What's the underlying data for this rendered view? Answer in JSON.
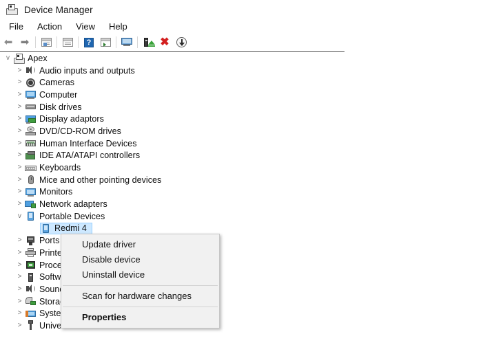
{
  "window": {
    "title": "Device Manager",
    "icon": "device-manager-icon"
  },
  "menubar": {
    "items": [
      {
        "label": "File"
      },
      {
        "label": "Action"
      },
      {
        "label": "View"
      },
      {
        "label": "Help"
      }
    ]
  },
  "toolbar": {
    "buttons": [
      {
        "icon": "back-arrow-icon",
        "label": "Back"
      },
      {
        "icon": "forward-arrow-icon",
        "label": "Forward"
      },
      {
        "icon": "show-hidden-devices-icon",
        "label": "Show hidden devices"
      },
      {
        "icon": "properties-icon",
        "label": "Properties"
      },
      {
        "icon": "help-icon",
        "label": "Help"
      },
      {
        "icon": "update-driver-icon",
        "label": "Update driver"
      },
      {
        "icon": "scan-hardware-icon",
        "label": "Scan for hardware changes"
      },
      {
        "icon": "enable-device-icon",
        "label": "Enable device"
      },
      {
        "icon": "uninstall-device-icon",
        "label": "Uninstall device"
      },
      {
        "icon": "download-icon",
        "label": "Download"
      }
    ]
  },
  "tree": {
    "nodes": [
      {
        "label": "Apex",
        "level": 0,
        "chevron": "v",
        "icon": "computer-root-icon",
        "selected": false
      },
      {
        "label": "Audio inputs and outputs",
        "level": 1,
        "chevron": ">",
        "icon": "speaker-icon",
        "selected": false
      },
      {
        "label": "Cameras",
        "level": 1,
        "chevron": ">",
        "icon": "camera-icon",
        "selected": false
      },
      {
        "label": "Computer",
        "level": 1,
        "chevron": ">",
        "icon": "computer-icon",
        "selected": false
      },
      {
        "label": "Disk drives",
        "level": 1,
        "chevron": ">",
        "icon": "disk-drive-icon",
        "selected": false
      },
      {
        "label": "Display adaptors",
        "level": 1,
        "chevron": ">",
        "icon": "display-adapter-icon",
        "selected": false
      },
      {
        "label": "DVD/CD-ROM drives",
        "level": 1,
        "chevron": ">",
        "icon": "dvd-drive-icon",
        "selected": false
      },
      {
        "label": "Human Interface Devices",
        "level": 1,
        "chevron": ">",
        "icon": "hid-icon",
        "selected": false
      },
      {
        "label": "IDE ATA/ATAPI controllers",
        "level": 1,
        "chevron": ">",
        "icon": "ide-controller-icon",
        "selected": false
      },
      {
        "label": "Keyboards",
        "level": 1,
        "chevron": ">",
        "icon": "keyboard-icon",
        "selected": false
      },
      {
        "label": "Mice and other pointing devices",
        "level": 1,
        "chevron": ">",
        "icon": "mouse-icon",
        "selected": false
      },
      {
        "label": "Monitors",
        "level": 1,
        "chevron": ">",
        "icon": "monitor-icon",
        "selected": false
      },
      {
        "label": "Network adapters",
        "level": 1,
        "chevron": ">",
        "icon": "network-adapter-icon",
        "selected": false
      },
      {
        "label": "Portable Devices",
        "level": 1,
        "chevron": "v",
        "icon": "portable-device-icon",
        "selected": false
      },
      {
        "label": "Redmi 4",
        "level": 2,
        "chevron": "",
        "icon": "portable-device-icon",
        "selected": true
      },
      {
        "label": "Ports (COM & LPT)",
        "level": 1,
        "chevron": ">",
        "icon": "ports-icon",
        "selected": false
      },
      {
        "label": "Printers",
        "level": 1,
        "chevron": ">",
        "icon": "printer-icon",
        "selected": false
      },
      {
        "label": "Processors",
        "level": 1,
        "chevron": ">",
        "icon": "processor-icon",
        "selected": false
      },
      {
        "label": "Software devices",
        "level": 1,
        "chevron": ">",
        "icon": "software-device-icon",
        "selected": false
      },
      {
        "label": "Sound, video and game controllers",
        "level": 1,
        "chevron": ">",
        "icon": "sound-icon",
        "selected": false
      },
      {
        "label": "Storage controllers",
        "level": 1,
        "chevron": ">",
        "icon": "storage-controller-icon",
        "selected": false
      },
      {
        "label": "System devices",
        "level": 1,
        "chevron": ">",
        "icon": "system-device-icon",
        "selected": false
      },
      {
        "label": "Universal Serial Bus controllers",
        "level": 1,
        "chevron": ">",
        "icon": "usb-icon",
        "selected": false
      }
    ]
  },
  "context_menu": {
    "items": [
      {
        "label": "Update driver",
        "type": "item",
        "bold": false
      },
      {
        "label": "Disable device",
        "type": "item",
        "bold": false
      },
      {
        "label": "Uninstall device",
        "type": "item",
        "bold": false
      },
      {
        "label": "",
        "type": "separator",
        "bold": false
      },
      {
        "label": "Scan for hardware changes",
        "type": "item",
        "bold": false
      },
      {
        "label": "",
        "type": "separator",
        "bold": false
      },
      {
        "label": "Properties",
        "type": "item",
        "bold": true
      }
    ]
  },
  "colors": {
    "selection": "#cde8ff",
    "menu_bg": "#f1f1f1",
    "accent_blue": "#1f66b0",
    "uninstall_red": "#d32020",
    "enable_green": "#3aa23a"
  }
}
